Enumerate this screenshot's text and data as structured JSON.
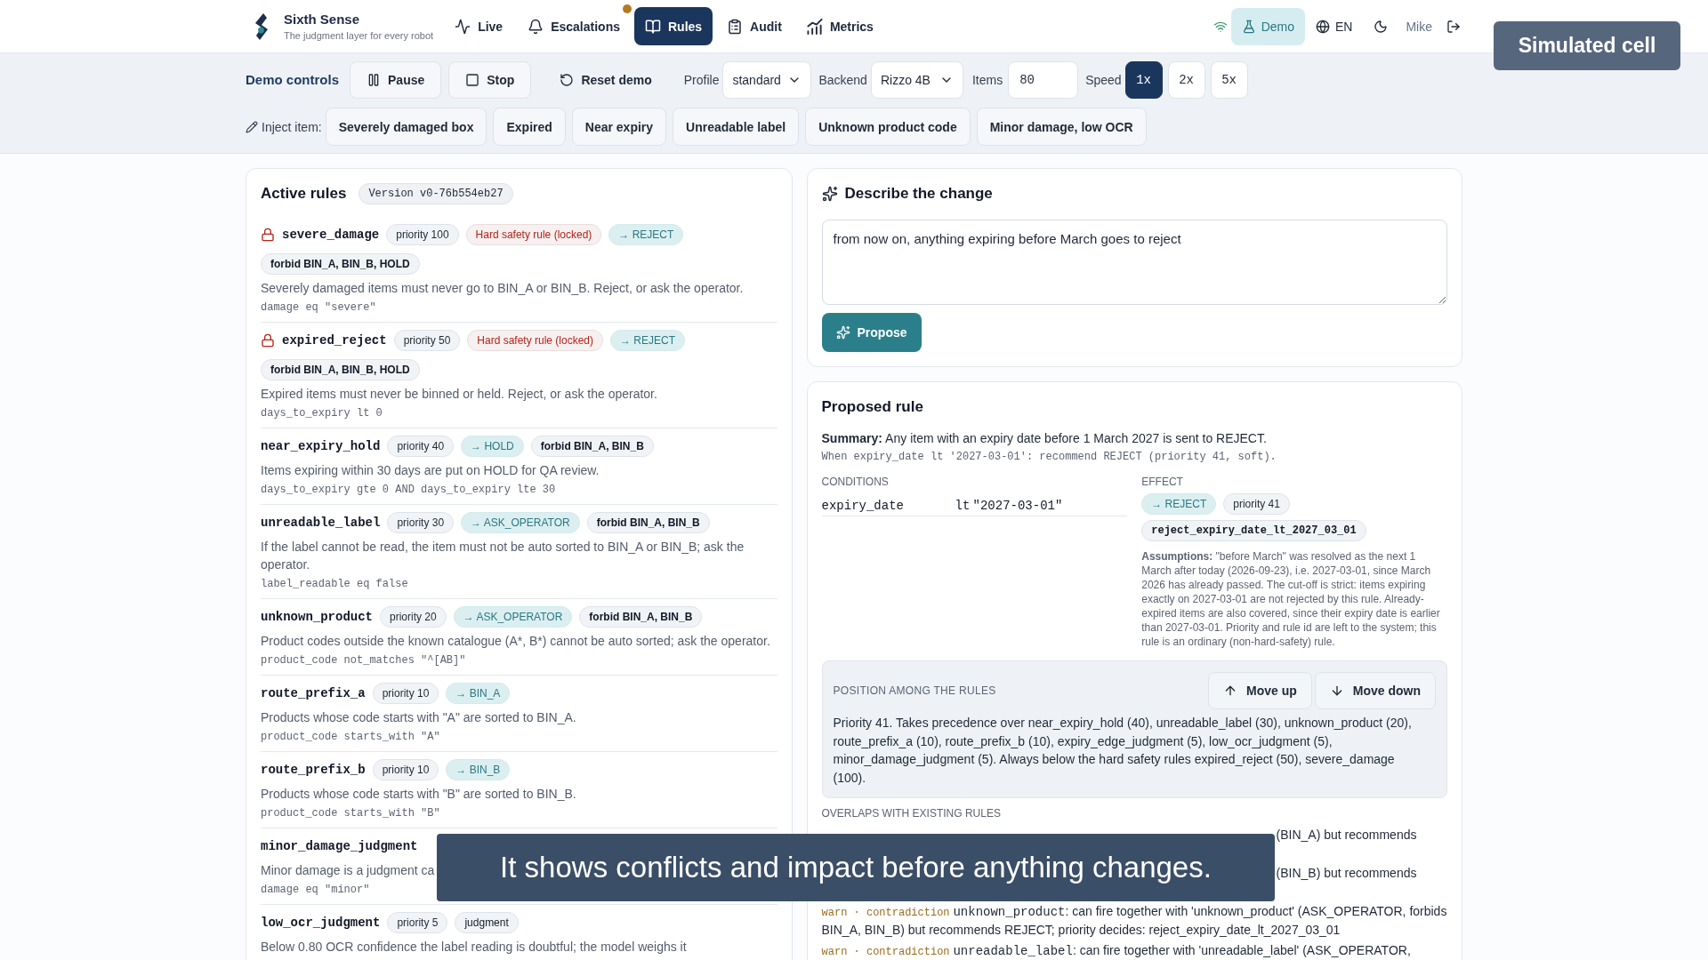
{
  "header": {
    "brand": {
      "name": "Sixth Sense",
      "tagline": "The judgment layer for every robot"
    },
    "nav": [
      {
        "label": "Live",
        "selected": false,
        "notification": false
      },
      {
        "label": "Escalations",
        "selected": false,
        "notification": true
      },
      {
        "label": "Rules",
        "selected": true,
        "notification": false
      },
      {
        "label": "Audit",
        "selected": false,
        "notification": false
      },
      {
        "label": "Metrics",
        "selected": false,
        "notification": false
      }
    ],
    "mode": {
      "label": "Demo",
      "on": true
    },
    "language": "EN",
    "user": "Mike"
  },
  "overlay_label": "Simulated cell",
  "demo_controls": {
    "label": "Demo controls",
    "buttons": [
      {
        "label": "Pause",
        "kind": "outline"
      },
      {
        "label": "Stop",
        "kind": "outline"
      },
      {
        "label": "Reset demo",
        "kind": "plain"
      }
    ],
    "profile": {
      "label": "Profile",
      "value": "standard"
    },
    "backend": {
      "label": "Backend",
      "value": "Rizzo 4B"
    },
    "items": {
      "label": "Items",
      "value": "80"
    },
    "speed": {
      "label": "Speed",
      "options": [
        {
          "label": "1x",
          "selected": true
        },
        {
          "label": "2x",
          "selected": false
        },
        {
          "label": "5x",
          "selected": false
        }
      ]
    }
  },
  "inject": {
    "label": "Inject item:",
    "items": [
      "Severely damaged box",
      "Expired",
      "Near expiry",
      "Unreadable label",
      "Unknown product code",
      "Minor damage, low OCR"
    ]
  },
  "active_rules": {
    "title": "Active rules",
    "version": "Version v0-76b554eb27",
    "rules": [
      {
        "name": "severe_damage",
        "locked": true,
        "badges": [
          {
            "kind": "priority",
            "text": "priority 100"
          },
          {
            "kind": "safety",
            "text": "Hard safety rule (locked)"
          },
          {
            "kind": "action",
            "text": "→ REJECT"
          },
          {
            "kind": "forbid",
            "text": "forbid BIN_A, BIN_B, HOLD"
          }
        ],
        "description": "Severely damaged items must never go to BIN_A or BIN_B. Reject, or ask the operator.",
        "condition": "damage eq \"severe\""
      },
      {
        "name": "expired_reject",
        "locked": true,
        "badges": [
          {
            "kind": "priority",
            "text": "priority 50"
          },
          {
            "kind": "safety",
            "text": "Hard safety rule (locked)"
          },
          {
            "kind": "action",
            "text": "→ REJECT"
          },
          {
            "kind": "forbid",
            "text": "forbid BIN_A, BIN_B, HOLD"
          }
        ],
        "description": "Expired items must never be binned or held. Reject, or ask the operator.",
        "condition": "days_to_expiry lt 0"
      },
      {
        "name": "near_expiry_hold",
        "locked": false,
        "badges": [
          {
            "kind": "priority",
            "text": "priority 40"
          },
          {
            "kind": "action",
            "text": "→ HOLD"
          },
          {
            "kind": "forbid",
            "text": "forbid BIN_A, BIN_B"
          }
        ],
        "description": "Items expiring within 30 days are put on HOLD for QA review.",
        "condition": "days_to_expiry gte 0 AND days_to_expiry lte 30"
      },
      {
        "name": "unreadable_label",
        "locked": false,
        "badges": [
          {
            "kind": "priority",
            "text": "priority 30"
          },
          {
            "kind": "action",
            "text": "→ ASK_OPERATOR"
          },
          {
            "kind": "forbid",
            "text": "forbid BIN_A, BIN_B"
          }
        ],
        "description": "If the label cannot be read, the item must not be auto sorted to BIN_A or BIN_B; ask the operator.",
        "condition": "label_readable eq false"
      },
      {
        "name": "unknown_product",
        "locked": false,
        "badges": [
          {
            "kind": "priority",
            "text": "priority 20"
          },
          {
            "kind": "action",
            "text": "→ ASK_OPERATOR"
          },
          {
            "kind": "forbid",
            "text": "forbid BIN_A, BIN_B"
          }
        ],
        "description": "Product codes outside the known catalogue (A*, B*) cannot be auto sorted; ask the operator.",
        "condition": "product_code not_matches \"^[AB]\""
      },
      {
        "name": "route_prefix_a",
        "locked": false,
        "badges": [
          {
            "kind": "priority",
            "text": "priority 10"
          },
          {
            "kind": "action",
            "text": "→ BIN_A"
          }
        ],
        "description": "Products whose code starts with \"A\" are sorted to BIN_A.",
        "condition": "product_code starts_with \"A\""
      },
      {
        "name": "route_prefix_b",
        "locked": false,
        "badges": [
          {
            "kind": "priority",
            "text": "priority 10"
          },
          {
            "kind": "action",
            "text": "→ BIN_B"
          }
        ],
        "description": "Products whose code starts with \"B\" are sorted to BIN_B.",
        "condition": "product_code starts_with \"B\""
      },
      {
        "name": "minor_damage_judgment",
        "locked": false,
        "description": "Minor damage is a judgment ca",
        "condition": "damage eq \"minor\""
      },
      {
        "name": "low_ocr_judgment",
        "locked": false,
        "badges": [
          {
            "kind": "priority",
            "text": "priority 5"
          },
          {
            "kind": "judgment",
            "text": "judgment"
          }
        ],
        "description": "Below 0.80 OCR confidence the label reading is doubtful; the model weighs it"
      }
    ]
  },
  "describe_change": {
    "title": "Describe the change",
    "text": "from now on, anything expiring before March goes to reject",
    "button": "Propose"
  },
  "proposed_rule": {
    "title": "Proposed rule",
    "summary": "**Summary:** Any item with an expiry date before 1 March 2027 is sent to REJECT.",
    "explanation": "When expiry_date lt '2027-03-01': recommend REJECT (priority 41, soft).",
    "conditions": {
      "label": "CONDITIONS",
      "rows": [
        {
          "field": "expiry_date",
          "operator": "lt",
          "value": "\"2027-03-01\""
        }
      ]
    },
    "effect": {
      "label": "EFFECT",
      "badges": [
        {
          "kind": "action",
          "text": "→ REJECT"
        },
        {
          "kind": "priority",
          "text": "priority 41"
        },
        {
          "kind": "id",
          "text": "reject_expiry_date_lt_2027_03_01"
        }
      ],
      "assumptions": "**Assumptions:** \"before March\" was resolved as the next 1 March after today (2026-09-23), i.e. 2027-03-01, since March 2026 has already passed. The cut-off is strict: items expiring exactly on 2027-03-01 are not rejected by this rule. Already-expired items are also covered, since their expiry date is earlier than 2027-03-01. Priority and rule id are left to the system; this rule is an ordinary (non-hard-safety) rule."
    },
    "position": {
      "label": "POSITION AMONG THE RULES",
      "buttons": [
        {
          "label": "Move up"
        },
        {
          "label": "Move down"
        }
      ],
      "text": "Priority 41. Takes precedence over near_expiry_hold (40), unreadable_label (30), unknown_product (20), route_prefix_a (10), route_prefix_b (10), expiry_edge_judgment (5), low_ocr_judgment (5), minor_damage_judgment (5). Always below the hard safety rules expired_reject (50), severe_damage (100)."
    },
    "overlaps": {
      "label": "OVERLAPS WITH EXISTING RULES",
      "items": [
        {
          "kind": "covered",
          "text": "(BIN_A) but recommends"
        },
        {
          "kind": "covered",
          "text": "(BIN_B) but recommends"
        },
        {
          "kind": "full",
          "tag": "warn · contradiction",
          "rule": "unknown_product",
          "message": ": can fire together with 'unknown_product' (ASK_OPERATOR, forbids BIN_A, BIN_B) but recommends REJECT; priority decides: reject_expiry_date_lt_2027_03_01"
        },
        {
          "kind": "full",
          "tag": "warn · contradiction",
          "rule": "unreadable_label",
          "message": ": can fire together with 'unreadable_label' (ASK_OPERATOR,"
        }
      ]
    }
  },
  "caption": "It shows conflicts and impact before anything changes."
}
